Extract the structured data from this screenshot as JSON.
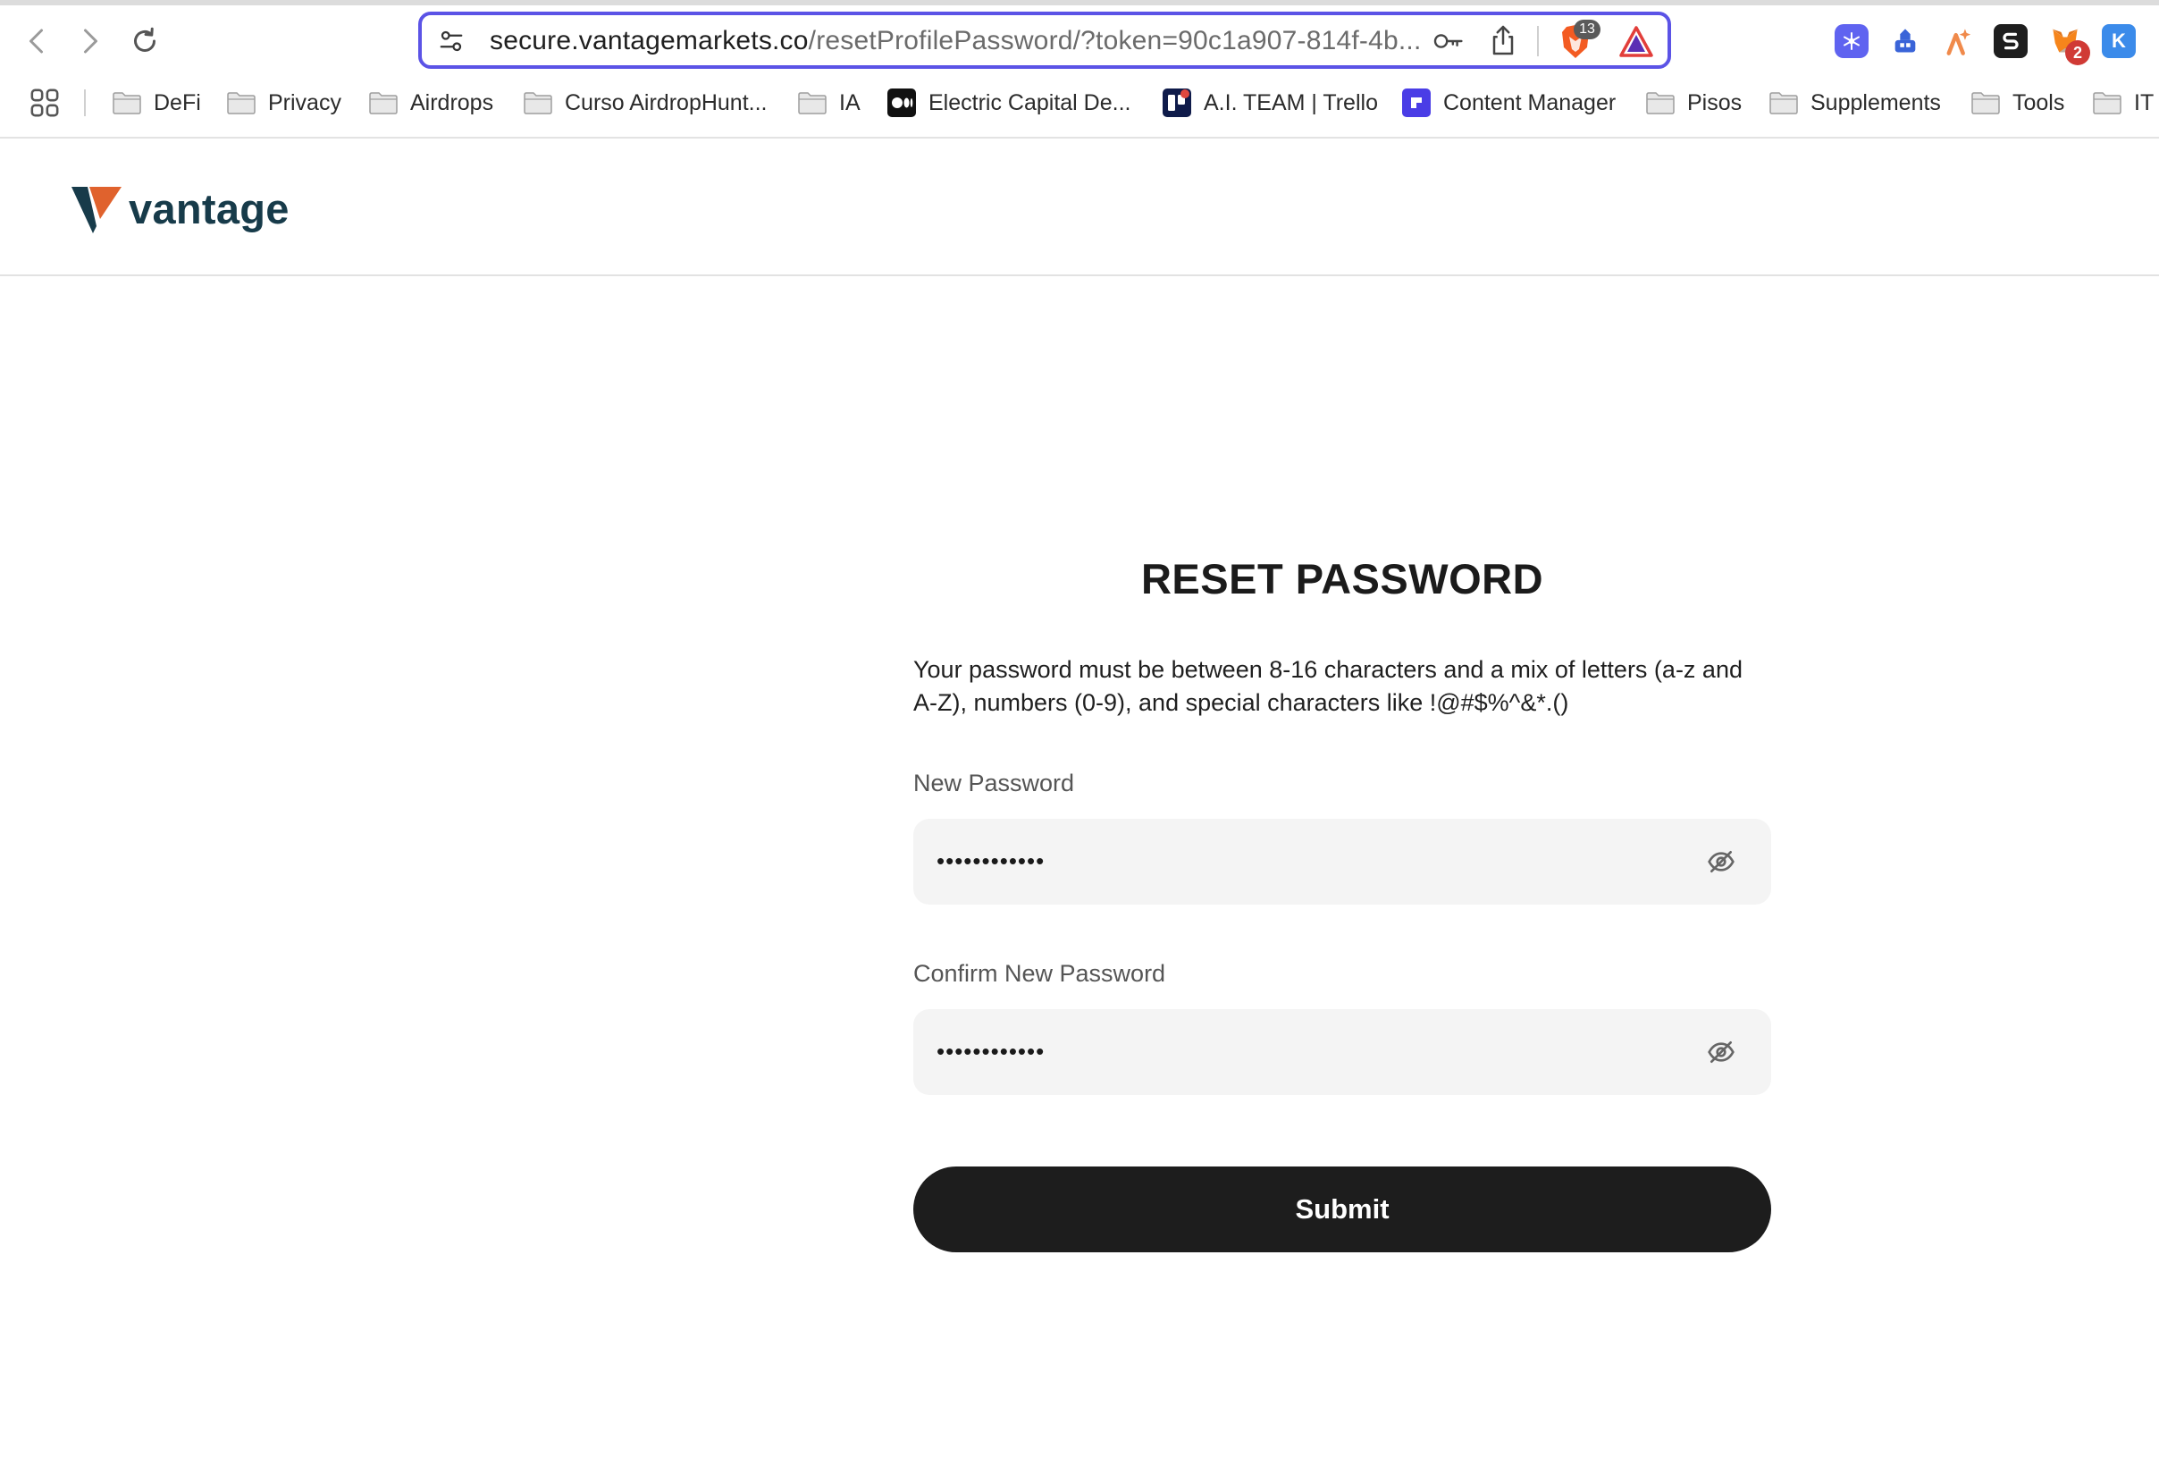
{
  "browser": {
    "url_host": "secure.vantagemarkets.co",
    "url_rest": "/resetProfilePassword/?token=90c1a907-814f-4b...",
    "shields_count": "13",
    "extension_badge": "2",
    "extension_k_label": "K",
    "bookmarks": [
      {
        "label": "DeFi",
        "icon": "folder-icon"
      },
      {
        "label": "Privacy",
        "icon": "folder-icon"
      },
      {
        "label": "Airdrops",
        "icon": "folder-icon"
      },
      {
        "label": "Curso AirdropHunt...",
        "icon": "folder-icon"
      },
      {
        "label": "IA",
        "icon": "folder-icon"
      },
      {
        "label": "Electric Capital De...",
        "icon": "medium-icon"
      },
      {
        "label": "A.I. TEAM | Trello",
        "icon": "trello-icon"
      },
      {
        "label": "Content Manager",
        "icon": "content-manager-icon"
      },
      {
        "label": "Pisos",
        "icon": "folder-icon"
      },
      {
        "label": "Supplements",
        "icon": "folder-icon"
      },
      {
        "label": "Tools",
        "icon": "folder-icon"
      },
      {
        "label": "IT",
        "icon": "folder-icon"
      }
    ]
  },
  "site": {
    "logo_text": "vantage",
    "brand_colors": {
      "navy": "#173b4a",
      "orange": "#e0622d"
    }
  },
  "form": {
    "title": "RESET PASSWORD",
    "description": "Your password must be between 8-16 characters and a mix of letters (a-z and A-Z), numbers (0-9), and special characters like !@#$%^&*.()",
    "new_password_label": "New Password",
    "new_password_value": "••••••••••••",
    "confirm_password_label": "Confirm New Password",
    "confirm_password_value": "••••••••••••",
    "submit_label": "Submit"
  }
}
